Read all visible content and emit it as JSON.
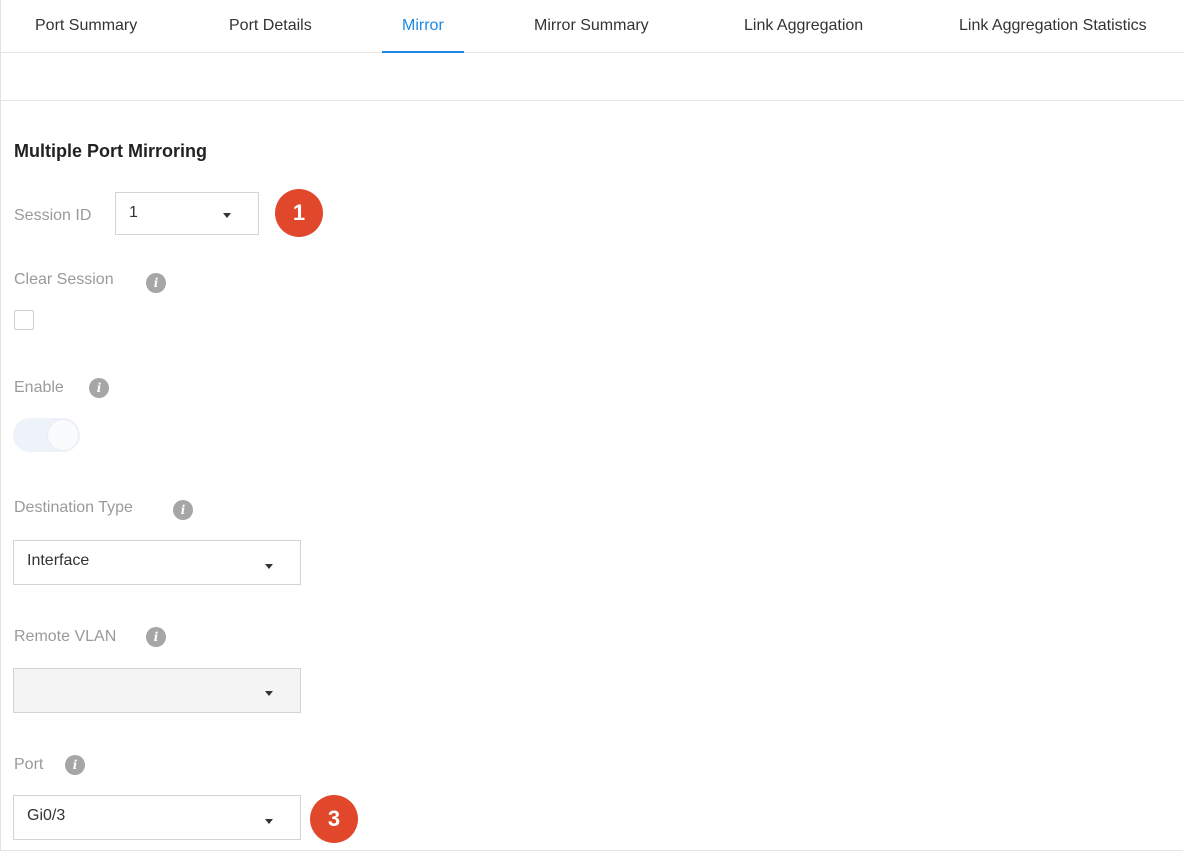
{
  "tabs": [
    {
      "label": "Port Summary"
    },
    {
      "label": "Port Details"
    },
    {
      "label": "Mirror"
    },
    {
      "label": "Mirror Summary"
    },
    {
      "label": "Link Aggregation"
    },
    {
      "label": "Link Aggregation Statistics"
    }
  ],
  "active_tab": "Mirror",
  "colors": {
    "accent": "#1e88e5",
    "callout": "#e0472b",
    "label": "#9a9a9a"
  },
  "section": {
    "title": "Multiple Port Mirroring"
  },
  "session": {
    "label": "Session ID",
    "value": "1"
  },
  "clear_session": {
    "label": "Clear Session",
    "checked": false
  },
  "enable": {
    "label": "Enable",
    "on": false
  },
  "destination_type": {
    "label": "Destination Type",
    "value": "Interface"
  },
  "remote_vlan": {
    "label": "Remote VLAN",
    "value": ""
  },
  "port": {
    "label": "Port",
    "value": "Gi0/3"
  },
  "callouts": {
    "one": "1",
    "three": "3"
  }
}
